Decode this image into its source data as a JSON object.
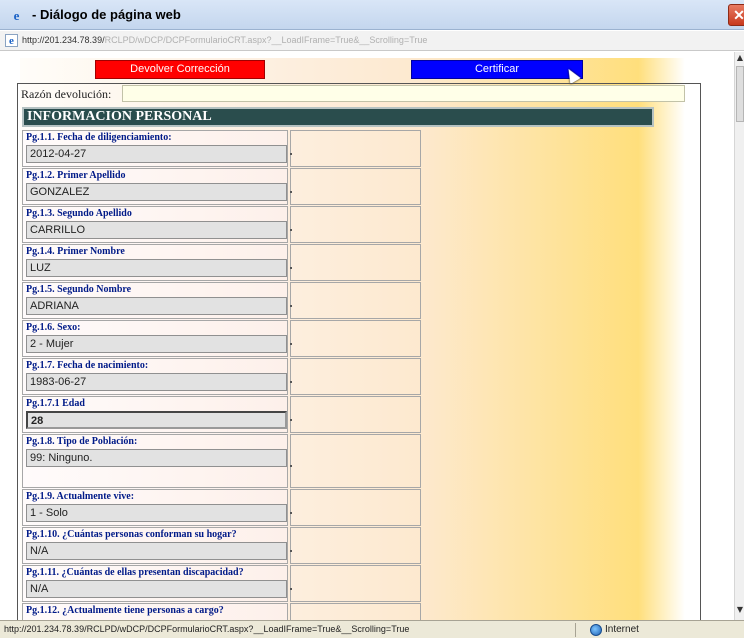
{
  "window": {
    "title": "- Diálogo de página web",
    "close_glyph": "✕",
    "ie_glyph": "e"
  },
  "address": {
    "host": "http://201.234.78.39/",
    "path": "RCLPD/wDCP/DCPFormularioCRT.aspx?__LoadIFrame=True&__Scrolling=True"
  },
  "toolbar": {
    "devolver_label": "Devolver Corrección",
    "certificar_label": "Certificar"
  },
  "razon": {
    "label": "Razón devolución:",
    "value": ""
  },
  "section_title": "INFORMACION PERSONAL",
  "fields": [
    {
      "label": "Pg.1.1. Fecha de diligenciamiento:",
      "value": "2012-04-27"
    },
    {
      "label": "Pg.1.2. Primer Apellido",
      "value": "GONZALEZ"
    },
    {
      "label": "Pg.1.3. Segundo Apellido",
      "value": "CARRILLO"
    },
    {
      "label": "Pg.1.4. Primer Nombre",
      "value": "LUZ"
    },
    {
      "label": "Pg.1.5. Segundo Nombre",
      "value": "ADRIANA"
    },
    {
      "label": "Pg.1.6. Sexo:",
      "value": "2 - Mujer"
    },
    {
      "label": "Pg.1.7. Fecha de nacimiento:",
      "value": "1983-06-27"
    },
    {
      "label": "Pg.1.7.1 Edad",
      "value": "28"
    },
    {
      "label": "Pg.1.8. Tipo de Población:",
      "value": "99: Ninguno."
    },
    {
      "label": "Pg.1.9. Actualmente vive:",
      "value": "1 - Solo"
    },
    {
      "label": "Pg.1.10. ¿Cuántas personas conforman su hogar?",
      "value": "N/A"
    },
    {
      "label": "Pg.1.11. ¿Cuántas de ellas presentan discapacidad?",
      "value": "N/A"
    },
    {
      "label": "Pg.1.12. ¿Actualmente tiene personas a cargo?",
      "value": ""
    }
  ],
  "scrollbar": {
    "up": "▲",
    "down": "▼"
  },
  "status": {
    "url": "http://201.234.78.39/RCLPD/wDCP/DCPFormularioCRT.aspx?__LoadIFrame=True&__Scrolling=True",
    "zone": "Internet"
  }
}
